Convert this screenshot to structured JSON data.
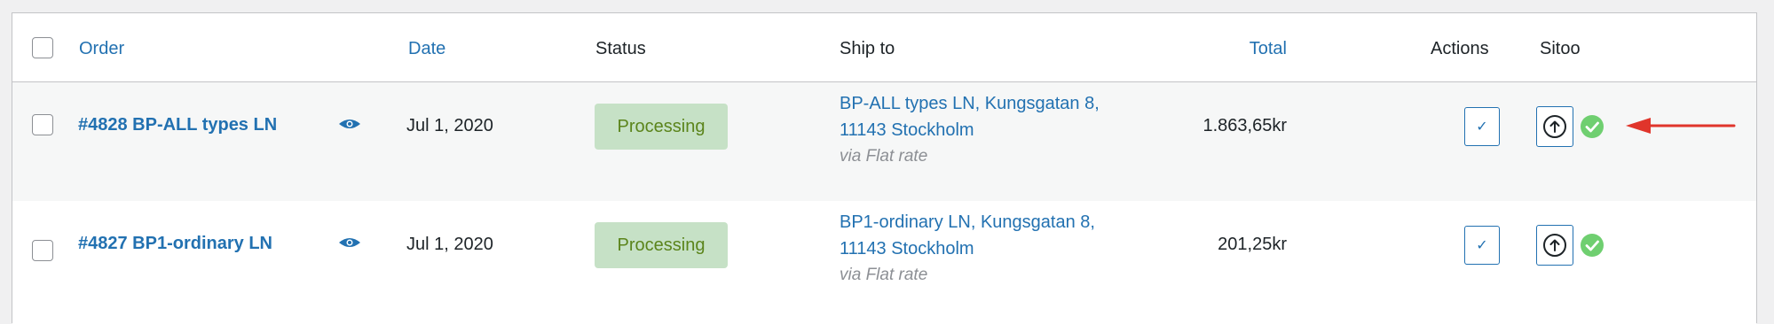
{
  "table": {
    "headers": {
      "order": "Order",
      "date": "Date",
      "status": "Status",
      "ship_to": "Ship to",
      "total": "Total",
      "actions": "Actions",
      "sitoo": "Sitoo"
    },
    "rows": [
      {
        "order": "#4828 BP-ALL types LN",
        "date": "Jul 1, 2020",
        "status": "Processing",
        "ship_line1": "BP-ALL types LN, Kungsgatan 8,",
        "ship_line2": "11143 Stockholm",
        "ship_via": "via Flat rate",
        "total": "1.863,65kr",
        "action_icon": "check-icon",
        "sitoo_icon": "upload-circle-icon",
        "sitoo_status_icon": "check-circle-icon",
        "annotation": "red-arrow-icon"
      },
      {
        "order": "#4827 BP1-ordinary LN",
        "date": "Jul 1, 2020",
        "status": "Processing",
        "ship_line1": "BP1-ordinary LN, Kungsgatan 8,",
        "ship_line2": "11143 Stockholm",
        "ship_via": "via Flat rate",
        "total": "201,25kr",
        "action_icon": "check-icon",
        "sitoo_icon": "upload-circle-icon",
        "sitoo_status_icon": "check-circle-icon"
      }
    ]
  },
  "colors": {
    "link": "#2271b1",
    "status_bg": "#c6e1c6",
    "status_text": "#5b841b",
    "success": "#6fcf70",
    "annotation": "#e0352b"
  }
}
